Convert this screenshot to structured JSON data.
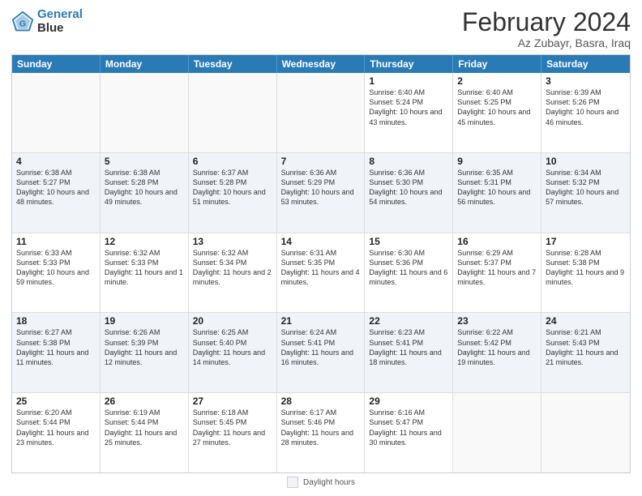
{
  "logo": {
    "line1": "General",
    "line2": "Blue"
  },
  "title": "February 2024",
  "subtitle": "Az Zubayr, Basra, Iraq",
  "header_days": [
    "Sunday",
    "Monday",
    "Tuesday",
    "Wednesday",
    "Thursday",
    "Friday",
    "Saturday"
  ],
  "weeks": [
    [
      {
        "day": "",
        "info": ""
      },
      {
        "day": "",
        "info": ""
      },
      {
        "day": "",
        "info": ""
      },
      {
        "day": "",
        "info": ""
      },
      {
        "day": "1",
        "info": "Sunrise: 6:40 AM\nSunset: 5:24 PM\nDaylight: 10 hours and 43 minutes."
      },
      {
        "day": "2",
        "info": "Sunrise: 6:40 AM\nSunset: 5:25 PM\nDaylight: 10 hours and 45 minutes."
      },
      {
        "day": "3",
        "info": "Sunrise: 6:39 AM\nSunset: 5:26 PM\nDaylight: 10 hours and 46 minutes."
      }
    ],
    [
      {
        "day": "4",
        "info": "Sunrise: 6:38 AM\nSunset: 5:27 PM\nDaylight: 10 hours and 48 minutes."
      },
      {
        "day": "5",
        "info": "Sunrise: 6:38 AM\nSunset: 5:28 PM\nDaylight: 10 hours and 49 minutes."
      },
      {
        "day": "6",
        "info": "Sunrise: 6:37 AM\nSunset: 5:28 PM\nDaylight: 10 hours and 51 minutes."
      },
      {
        "day": "7",
        "info": "Sunrise: 6:36 AM\nSunset: 5:29 PM\nDaylight: 10 hours and 53 minutes."
      },
      {
        "day": "8",
        "info": "Sunrise: 6:36 AM\nSunset: 5:30 PM\nDaylight: 10 hours and 54 minutes."
      },
      {
        "day": "9",
        "info": "Sunrise: 6:35 AM\nSunset: 5:31 PM\nDaylight: 10 hours and 56 minutes."
      },
      {
        "day": "10",
        "info": "Sunrise: 6:34 AM\nSunset: 5:32 PM\nDaylight: 10 hours and 57 minutes."
      }
    ],
    [
      {
        "day": "11",
        "info": "Sunrise: 6:33 AM\nSunset: 5:33 PM\nDaylight: 10 hours and 59 minutes."
      },
      {
        "day": "12",
        "info": "Sunrise: 6:32 AM\nSunset: 5:33 PM\nDaylight: 11 hours and 1 minute."
      },
      {
        "day": "13",
        "info": "Sunrise: 6:32 AM\nSunset: 5:34 PM\nDaylight: 11 hours and 2 minutes."
      },
      {
        "day": "14",
        "info": "Sunrise: 6:31 AM\nSunset: 5:35 PM\nDaylight: 11 hours and 4 minutes."
      },
      {
        "day": "15",
        "info": "Sunrise: 6:30 AM\nSunset: 5:36 PM\nDaylight: 11 hours and 6 minutes."
      },
      {
        "day": "16",
        "info": "Sunrise: 6:29 AM\nSunset: 5:37 PM\nDaylight: 11 hours and 7 minutes."
      },
      {
        "day": "17",
        "info": "Sunrise: 6:28 AM\nSunset: 5:38 PM\nDaylight: 11 hours and 9 minutes."
      }
    ],
    [
      {
        "day": "18",
        "info": "Sunrise: 6:27 AM\nSunset: 5:38 PM\nDaylight: 11 hours and 11 minutes."
      },
      {
        "day": "19",
        "info": "Sunrise: 6:26 AM\nSunset: 5:39 PM\nDaylight: 11 hours and 12 minutes."
      },
      {
        "day": "20",
        "info": "Sunrise: 6:25 AM\nSunset: 5:40 PM\nDaylight: 11 hours and 14 minutes."
      },
      {
        "day": "21",
        "info": "Sunrise: 6:24 AM\nSunset: 5:41 PM\nDaylight: 11 hours and 16 minutes."
      },
      {
        "day": "22",
        "info": "Sunrise: 6:23 AM\nSunset: 5:41 PM\nDaylight: 11 hours and 18 minutes."
      },
      {
        "day": "23",
        "info": "Sunrise: 6:22 AM\nSunset: 5:42 PM\nDaylight: 11 hours and 19 minutes."
      },
      {
        "day": "24",
        "info": "Sunrise: 6:21 AM\nSunset: 5:43 PM\nDaylight: 11 hours and 21 minutes."
      }
    ],
    [
      {
        "day": "25",
        "info": "Sunrise: 6:20 AM\nSunset: 5:44 PM\nDaylight: 11 hours and 23 minutes."
      },
      {
        "day": "26",
        "info": "Sunrise: 6:19 AM\nSunset: 5:44 PM\nDaylight: 11 hours and 25 minutes."
      },
      {
        "day": "27",
        "info": "Sunrise: 6:18 AM\nSunset: 5:45 PM\nDaylight: 11 hours and 27 minutes."
      },
      {
        "day": "28",
        "info": "Sunrise: 6:17 AM\nSunset: 5:46 PM\nDaylight: 11 hours and 28 minutes."
      },
      {
        "day": "29",
        "info": "Sunrise: 6:16 AM\nSunset: 5:47 PM\nDaylight: 11 hours and 30 minutes."
      },
      {
        "day": "",
        "info": ""
      },
      {
        "day": "",
        "info": ""
      }
    ]
  ],
  "footer": {
    "legend_label": "Daylight hours"
  }
}
